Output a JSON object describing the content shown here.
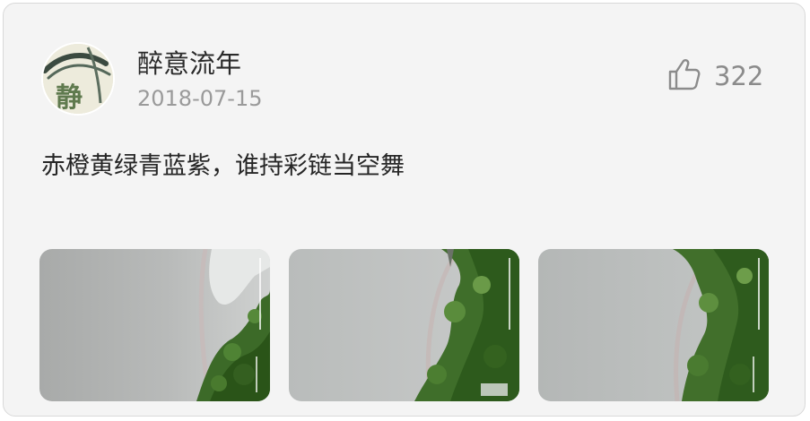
{
  "post": {
    "author": {
      "name": "醉意流年",
      "avatar_glyph": "静",
      "avatar_icon": "avatar-icon"
    },
    "date": "2018-07-15",
    "likes": {
      "count": "322",
      "icon": "thumbs-up-icon"
    },
    "text": "赤橙黄绿青蓝紫，谁持彩链当空舞",
    "photos": [
      {
        "label": "rainbow-photo-1"
      },
      {
        "label": "rainbow-photo-2"
      },
      {
        "label": "rainbow-photo-3"
      }
    ]
  },
  "colors": {
    "card_background": "#f4f4f4",
    "primary_text": "#262626",
    "secondary_text": "#9a9a9a",
    "icon_gray": "#8b8b8b"
  }
}
